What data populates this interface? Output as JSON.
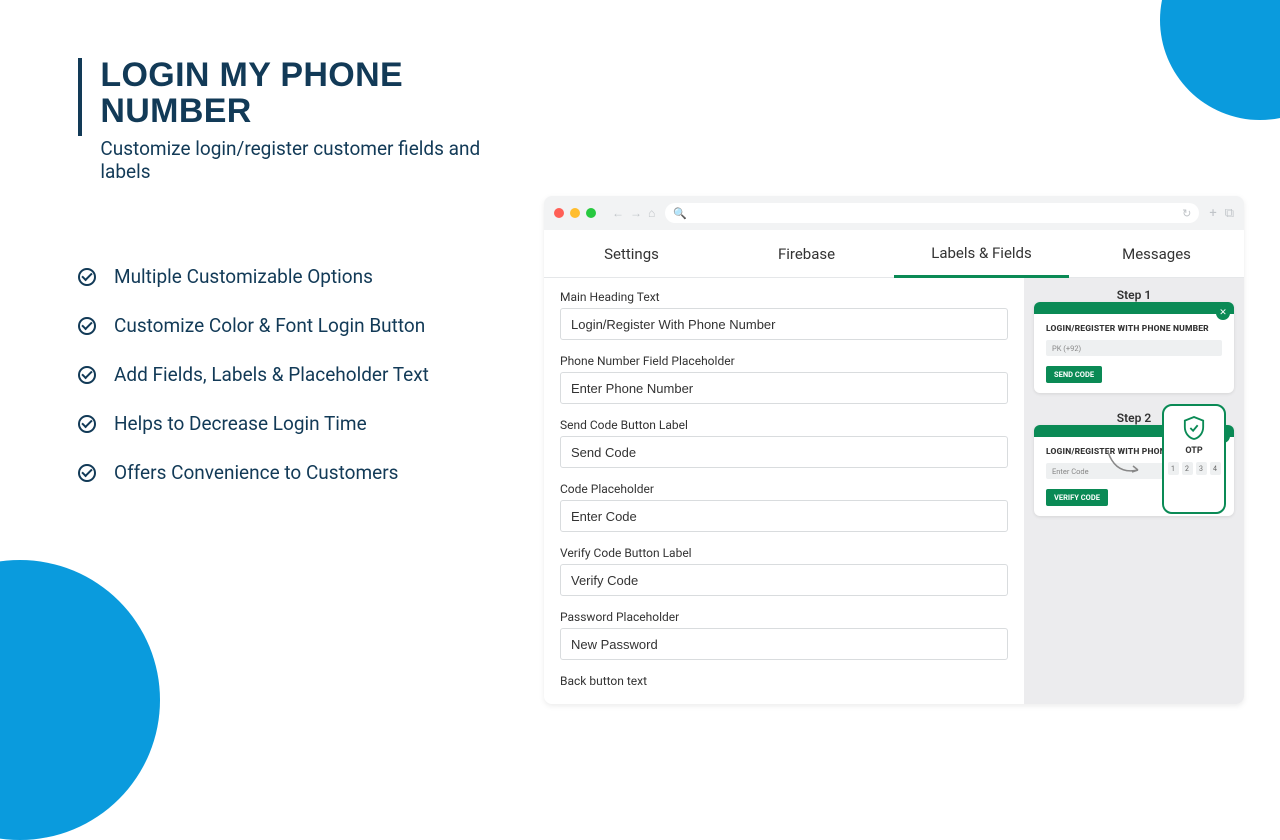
{
  "hero": {
    "title": "LOGIN MY PHONE NUMBER",
    "subtitle": "Customize login/register customer fields and labels"
  },
  "features": [
    "Multiple Customizable Options",
    "Customize Color & Font Login Button",
    "Add Fields, Labels & Placeholder Text",
    "Helps to Decrease Login Time",
    "Offers Convenience to Customers"
  ],
  "tabs": {
    "settings": "Settings",
    "firebase": "Firebase",
    "labels": "Labels & Fields",
    "messages": "Messages",
    "active": "labels"
  },
  "form": {
    "main_heading": {
      "label": "Main Heading Text",
      "value": "Login/Register With Phone Number"
    },
    "phone_ph": {
      "label": "Phone Number Field Placeholder",
      "value": "Enter Phone Number"
    },
    "send_code": {
      "label": "Send Code Button Label",
      "value": "Send Code"
    },
    "code_ph": {
      "label": "Code Placeholder",
      "value": "Enter Code"
    },
    "verify": {
      "label": "Verify Code Button Label",
      "value": "Verify Code"
    },
    "password_ph": {
      "label": "Password Placeholder",
      "value": "New Password"
    },
    "back_btn": {
      "label": "Back button text"
    }
  },
  "preview": {
    "step1": {
      "title": "Step 1",
      "heading": "LOGIN/REGISTER WITH PHONE NUMBER",
      "input": "PK (+92)",
      "button": "SEND CODE"
    },
    "step2": {
      "title": "Step 2",
      "heading": "LOGIN/REGISTER WITH PHONE NUMBER",
      "input": "Enter Code",
      "button": "VERIFY CODE",
      "otp_label": "OTP",
      "otp_digits": [
        "1",
        "2",
        "3",
        "4"
      ]
    }
  },
  "colors": {
    "brand_blue": "#0a9bdd",
    "dark_navy": "#123a57",
    "accent_green": "#0a8a55"
  }
}
